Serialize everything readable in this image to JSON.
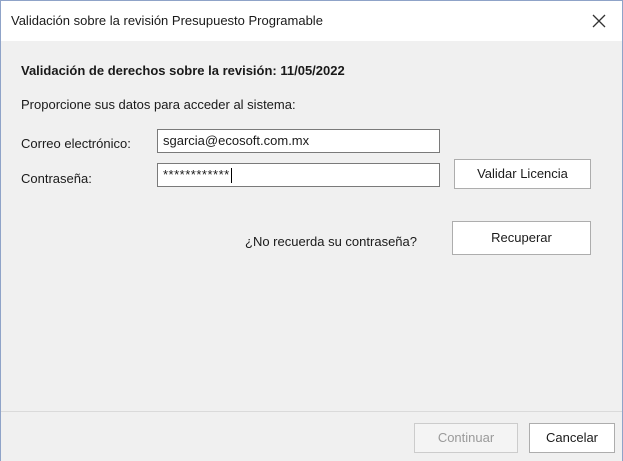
{
  "window": {
    "title": "Validación sobre la revisión Presupuesto Programable"
  },
  "form": {
    "heading": "Validación de derechos sobre la revisión: 11/05/2022",
    "prompt": "Proporcione sus datos para acceder al sistema:",
    "email_label": "Correo electrónico:",
    "email_value": "sgarcia@ecosoft.com.mx",
    "password_label": "Contraseña:",
    "password_value": "************",
    "validate_button": "Validar Licencia",
    "forgot_text": "¿No recuerda su contraseña?",
    "recover_button": "Recuperar"
  },
  "footer": {
    "continue_button": "Continuar",
    "cancel_button": "Cancelar"
  },
  "icons": {
    "close": "close-icon"
  },
  "colors": {
    "window_border": "#8fa3c8",
    "dialog_background": "#f0f0f0",
    "disabled_text": "#9a9a9a"
  }
}
